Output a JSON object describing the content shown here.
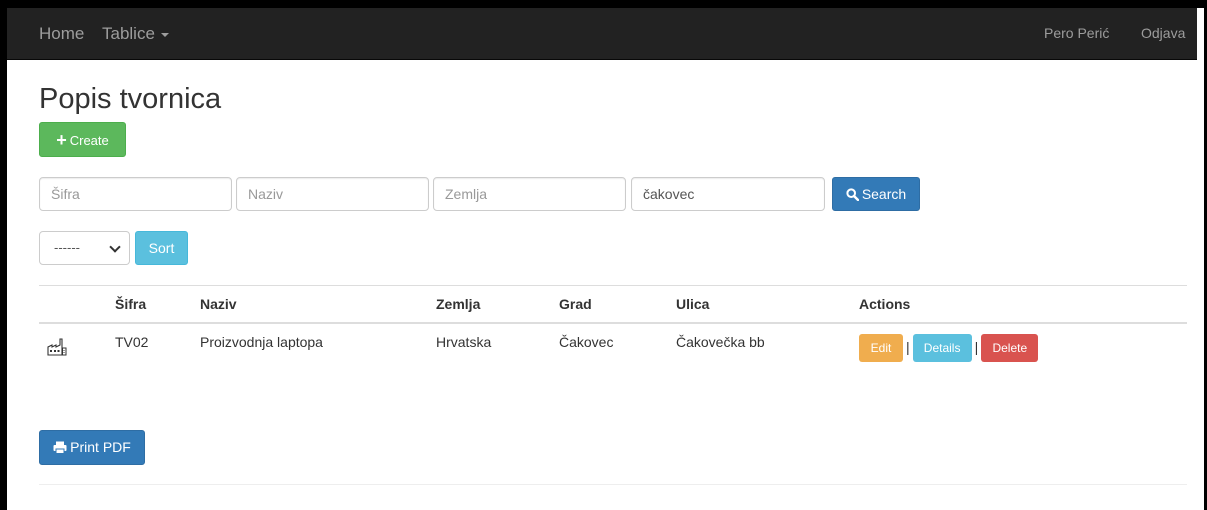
{
  "navbar": {
    "home": "Home",
    "tablice": "Tablice",
    "user": "Pero Perić",
    "logout": "Odjava"
  },
  "page": {
    "title": "Popis tvornica",
    "create_label": "Create"
  },
  "search": {
    "sifra_placeholder": "Šifra",
    "naziv_placeholder": "Naziv",
    "zemlja_placeholder": "Zemlja",
    "grad_value": "čakovec",
    "button_label": "Search"
  },
  "sort": {
    "selected": "------",
    "button_label": "Sort"
  },
  "table": {
    "headers": [
      "",
      "Šifra",
      "Naziv",
      "Zemlja",
      "Grad",
      "Ulica",
      "Actions"
    ],
    "rows": [
      {
        "sifra": "TV02",
        "naziv": "Proizvodnja laptopa",
        "zemlja": "Hrvatska",
        "grad": "Čakovec",
        "ulica": "Čakovečka bb",
        "icon": "factory-icon",
        "edit": "Edit",
        "details": "Details",
        "delete": "Delete",
        "sep": "|"
      }
    ]
  },
  "print_label": "Print PDF",
  "colors": {
    "navbar_bg": "#222222",
    "success": "#5cb85c",
    "primary": "#337ab7",
    "info": "#5bc0de",
    "warning": "#f0ad4e",
    "danger": "#d9534f"
  }
}
